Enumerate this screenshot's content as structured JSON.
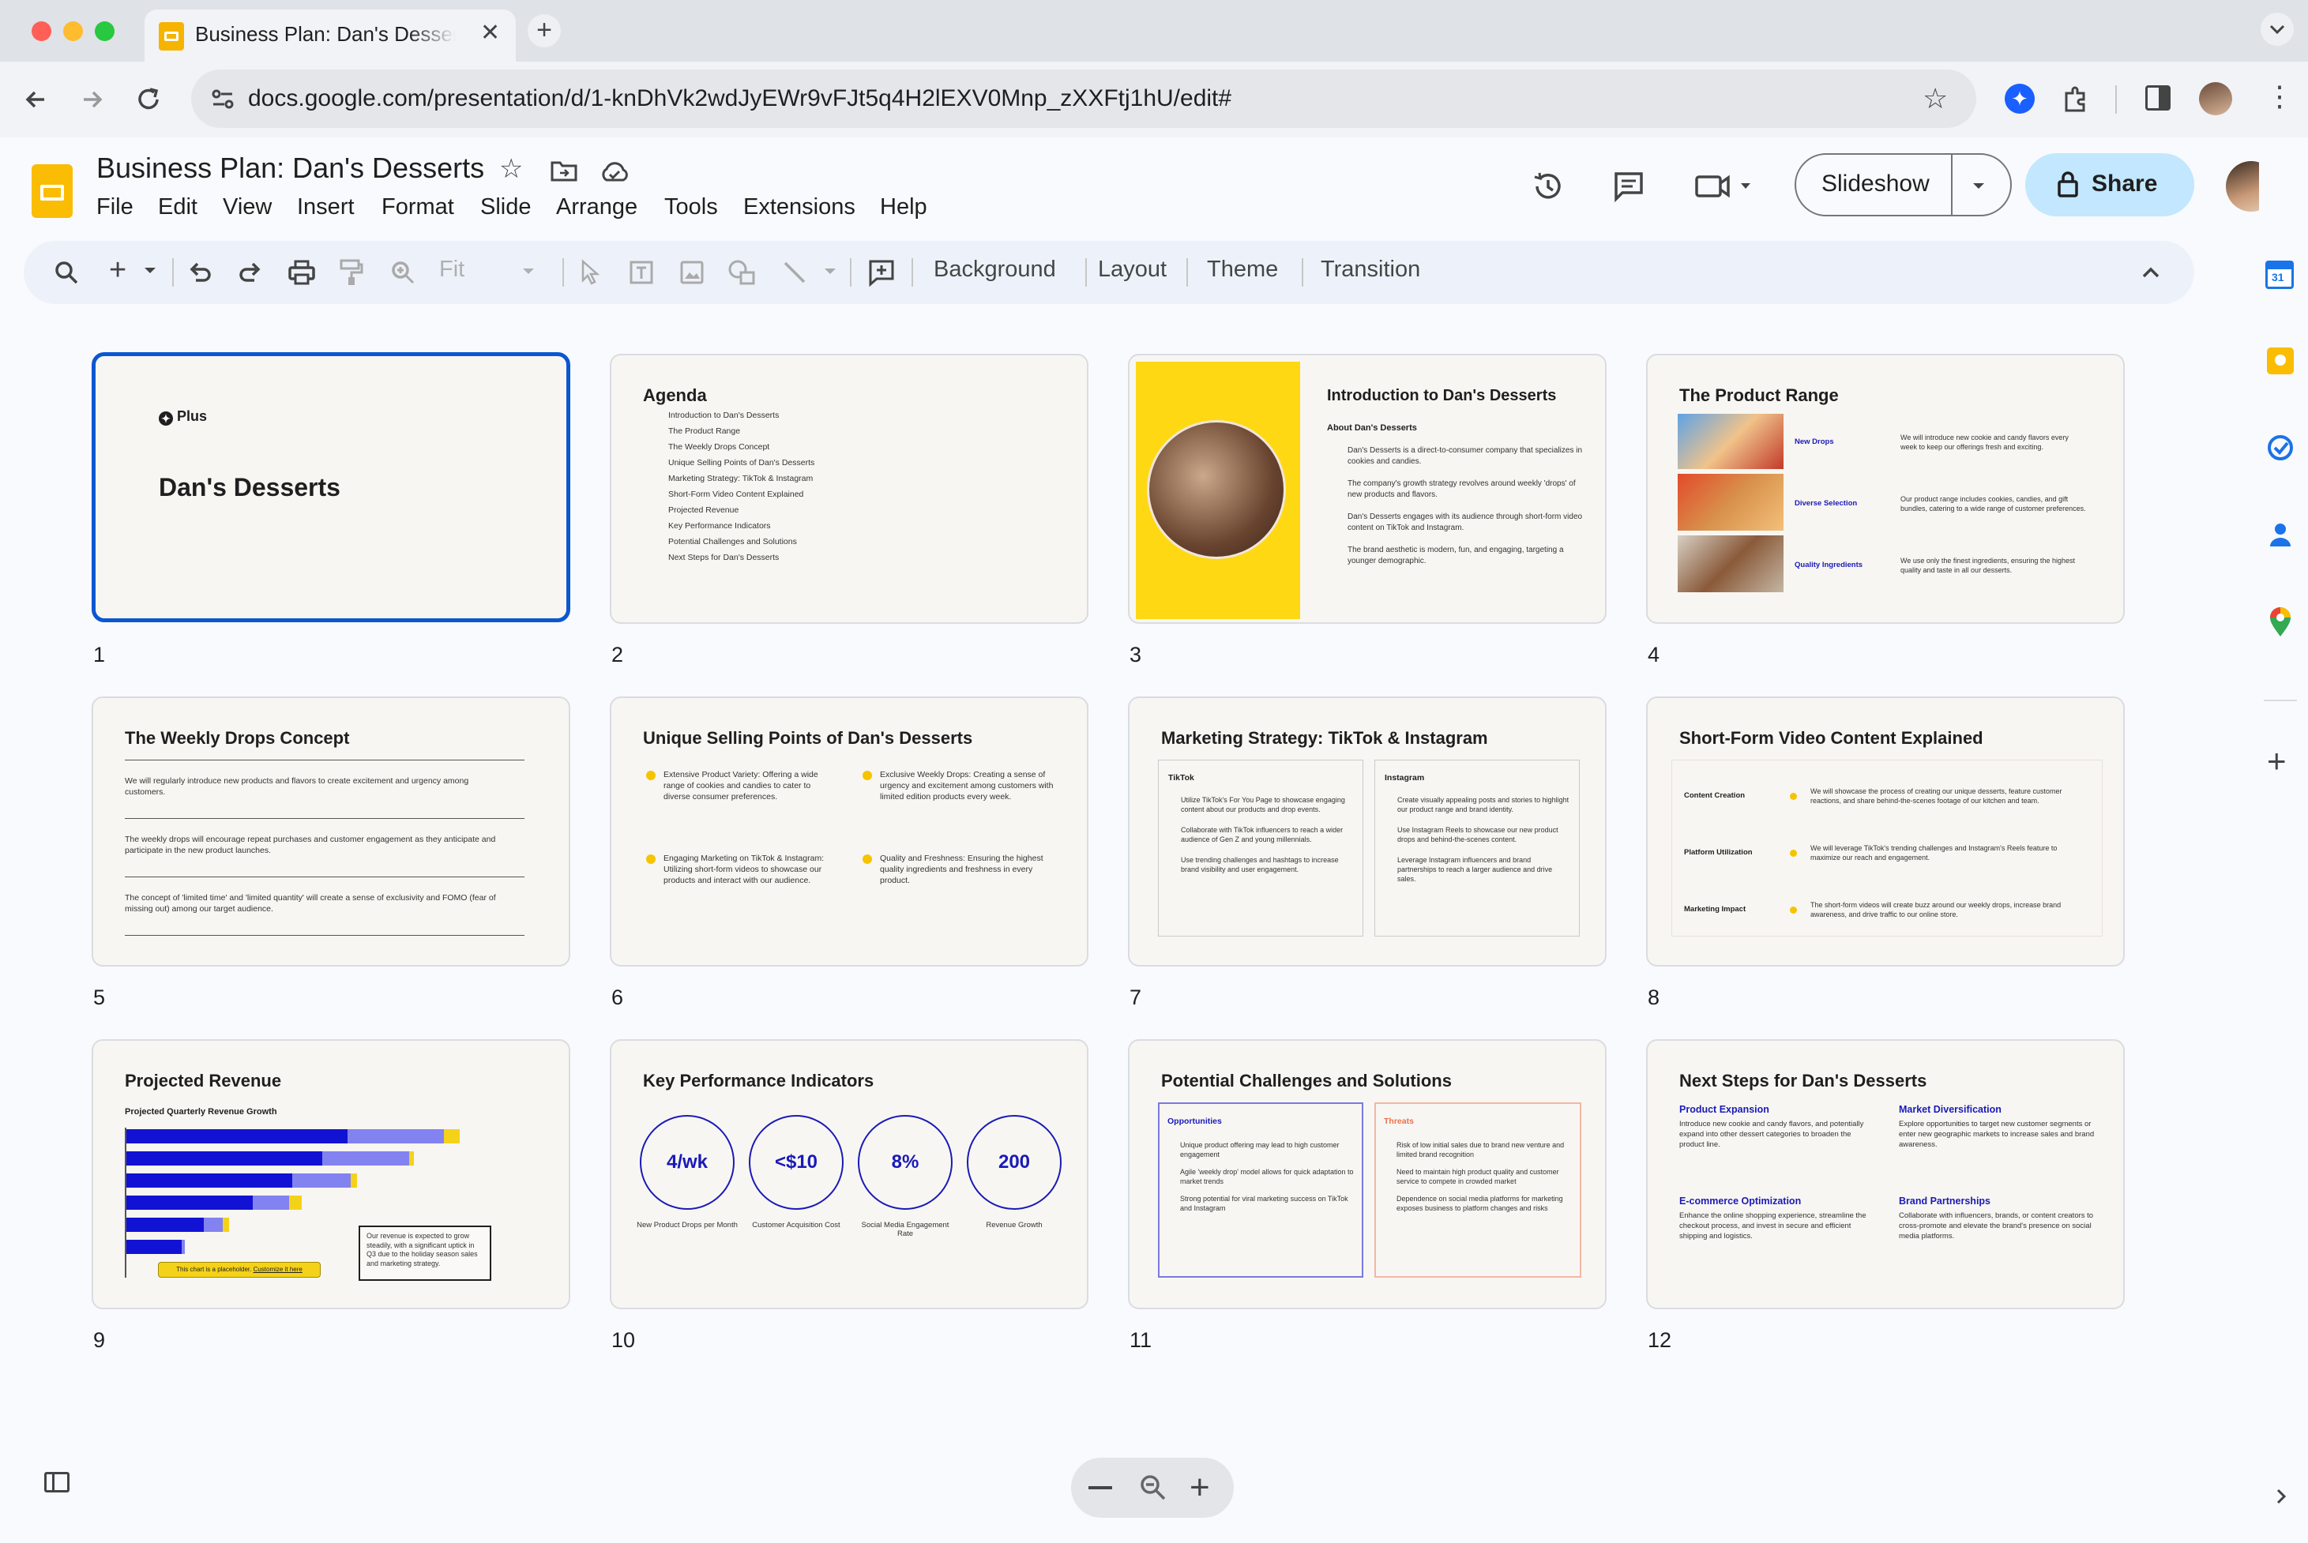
{
  "browser": {
    "tab_title": "Business Plan: Dan's Desserts",
    "url": "docs.google.com/presentation/d/1-knDhVk2wdJyEWr9vFJt5q4H2lEXV0Mnp_zXXFtj1hU/edit#"
  },
  "app": {
    "doc_title": "Business Plan: Dan's Desserts",
    "menus": [
      "File",
      "Edit",
      "View",
      "Insert",
      "Format",
      "Slide",
      "Arrange",
      "Tools",
      "Extensions",
      "Help"
    ],
    "slideshow_label": "Slideshow",
    "share_label": "Share",
    "accent": "#0b57d0",
    "share_bg": "#c2e7ff"
  },
  "toolbar": {
    "zoom_value": "Fit",
    "background": "Background",
    "layout": "Layout",
    "theme": "Theme",
    "transition": "Transition"
  },
  "slides": {
    "s1": {
      "num": "1",
      "brand": "Plus",
      "title": "Dan's Desserts"
    },
    "s2": {
      "num": "2",
      "title": "Agenda",
      "items": [
        "Introduction to Dan's Desserts",
        "The Product Range",
        "The Weekly Drops Concept",
        "Unique Selling Points of Dan's Desserts",
        "Marketing Strategy: TikTok & Instagram",
        "Short-Form Video Content Explained",
        "Projected Revenue",
        "Key Performance Indicators",
        "Potential Challenges and Solutions",
        "Next Steps for Dan's Desserts"
      ]
    },
    "s3": {
      "num": "3",
      "title": "Introduction to Dan's Desserts",
      "subtitle": "About Dan's Desserts",
      "bullets": [
        "Dan's Desserts is a direct-to-consumer company that specializes in cookies and candies.",
        "The company's growth strategy revolves around weekly 'drops' of new products and flavors.",
        "Dan's Desserts engages with its audience through short-form video content on TikTok and Instagram.",
        "The brand aesthetic is modern, fun, and engaging, targeting a younger demographic."
      ]
    },
    "s4": {
      "num": "4",
      "title": "The Product Range",
      "rows": [
        {
          "label": "New Drops",
          "text": "We will introduce new cookie and candy flavors every week to keep our offerings fresh and exciting."
        },
        {
          "label": "Diverse Selection",
          "text": "Our product range includes cookies, candies, and gift bundles, catering to a wide range of customer preferences."
        },
        {
          "label": "Quality Ingredients",
          "text": "We use only the finest ingredients, ensuring the highest quality and taste in all our desserts."
        }
      ]
    },
    "s5": {
      "num": "5",
      "title": "The Weekly Drops Concept",
      "paras": [
        "We will regularly introduce new products and flavors to create excitement and urgency among customers.",
        "The weekly drops will encourage repeat purchases and customer engagement as they anticipate and participate in the new product launches.",
        "The concept of 'limited time' and 'limited quantity' will create a sense of exclusivity and FOMO (fear of missing out) among our target audience."
      ]
    },
    "s6": {
      "num": "6",
      "title": "Unique Selling Points of Dan's Desserts",
      "points": [
        "Extensive Product Variety: Offering a wide range of cookies and candies to cater to diverse consumer preferences.",
        "Exclusive Weekly Drops: Creating a sense of urgency and excitement among customers with limited edition products every week.",
        "Engaging Marketing on TikTok & Instagram: Utilizing short-form videos to showcase our products and interact with our audience.",
        "Quality and Freshness: Ensuring the highest quality ingredients and freshness in every product."
      ]
    },
    "s7": {
      "num": "7",
      "title": "Marketing Strategy: TikTok & Instagram",
      "left_head": "TikTok",
      "left": [
        "Utilize TikTok's For You Page to showcase engaging content about our products and drop events.",
        "Collaborate with TikTok influencers to reach a wider audience of Gen Z and young millennials.",
        "Use trending challenges and hashtags to increase brand visibility and user engagement."
      ],
      "right_head": "Instagram",
      "right": [
        "Create visually appealing posts and stories to highlight our product range and brand identity.",
        "Use Instagram Reels to showcase our new product drops and behind-the-scenes content.",
        "Leverage Instagram influencers and brand partnerships to reach a larger audience and drive sales."
      ]
    },
    "s8": {
      "num": "8",
      "title": "Short-Form Video Content Explained",
      "rows": [
        {
          "label": "Content Creation",
          "text": "We will showcase the process of creating our unique desserts, feature customer reactions, and share behind-the-scenes footage of our kitchen and team."
        },
        {
          "label": "Platform Utilization",
          "text": "We will leverage TikTok's trending challenges and Instagram's Reels feature to maximize our reach and engagement."
        },
        {
          "label": "Marketing Impact",
          "text": "The short-form videos will create buzz around our weekly drops, increase brand awareness, and drive traffic to our online store."
        }
      ]
    },
    "s9": {
      "num": "9",
      "title": "Projected Revenue",
      "subtitle": "Projected Quarterly Revenue Growth",
      "note": "Our revenue is expected to grow steadily, with a significant uptick in Q3 due to the holiday season sales and marketing strategy.",
      "placeholder": "This chart is a placeholder.",
      "placeholder_link": "Customize it here"
    },
    "s10": {
      "num": "10",
      "title": "Key Performance Indicators",
      "kpis": [
        {
          "value": "4/wk",
          "label": "New Product Drops per Month"
        },
        {
          "value": "<$10",
          "label": "Customer Acquisition Cost"
        },
        {
          "value": "8%",
          "label": "Social Media Engagement Rate"
        },
        {
          "value": "200",
          "label": "Revenue Growth"
        }
      ]
    },
    "s11": {
      "num": "11",
      "title": "Potential Challenges and Solutions",
      "left_head": "Opportunities",
      "left": [
        "Unique product offering may lead to high customer engagement",
        "Agile 'weekly drop' model allows for quick adaptation to market trends",
        "Strong potential for viral marketing success on TikTok and Instagram"
      ],
      "right_head": "Threats",
      "right": [
        "Risk of low initial sales due to brand new venture and limited brand recognition",
        "Need to maintain high product quality and customer service to compete in crowded market",
        "Dependence on social media platforms for marketing exposes business to platform changes and risks"
      ]
    },
    "s12": {
      "num": "12",
      "title": "Next Steps for Dan's Desserts",
      "blocks": [
        {
          "head": "Product Expansion",
          "text": "Introduce new cookie and candy flavors, and potentially expand into other dessert categories to broaden the product line."
        },
        {
          "head": "Market Diversification",
          "text": "Explore opportunities to target new customer segments or enter new geographic markets to increase sales and brand awareness."
        },
        {
          "head": "E-commerce Optimization",
          "text": "Enhance the online shopping experience, streamline the checkout process, and invest in secure and efficient shipping and logistics."
        },
        {
          "head": "Brand Partnerships",
          "text": "Collaborate with influencers, brands, or content creators to cross-promote and elevate the brand's presence on social media platforms."
        }
      ]
    }
  }
}
